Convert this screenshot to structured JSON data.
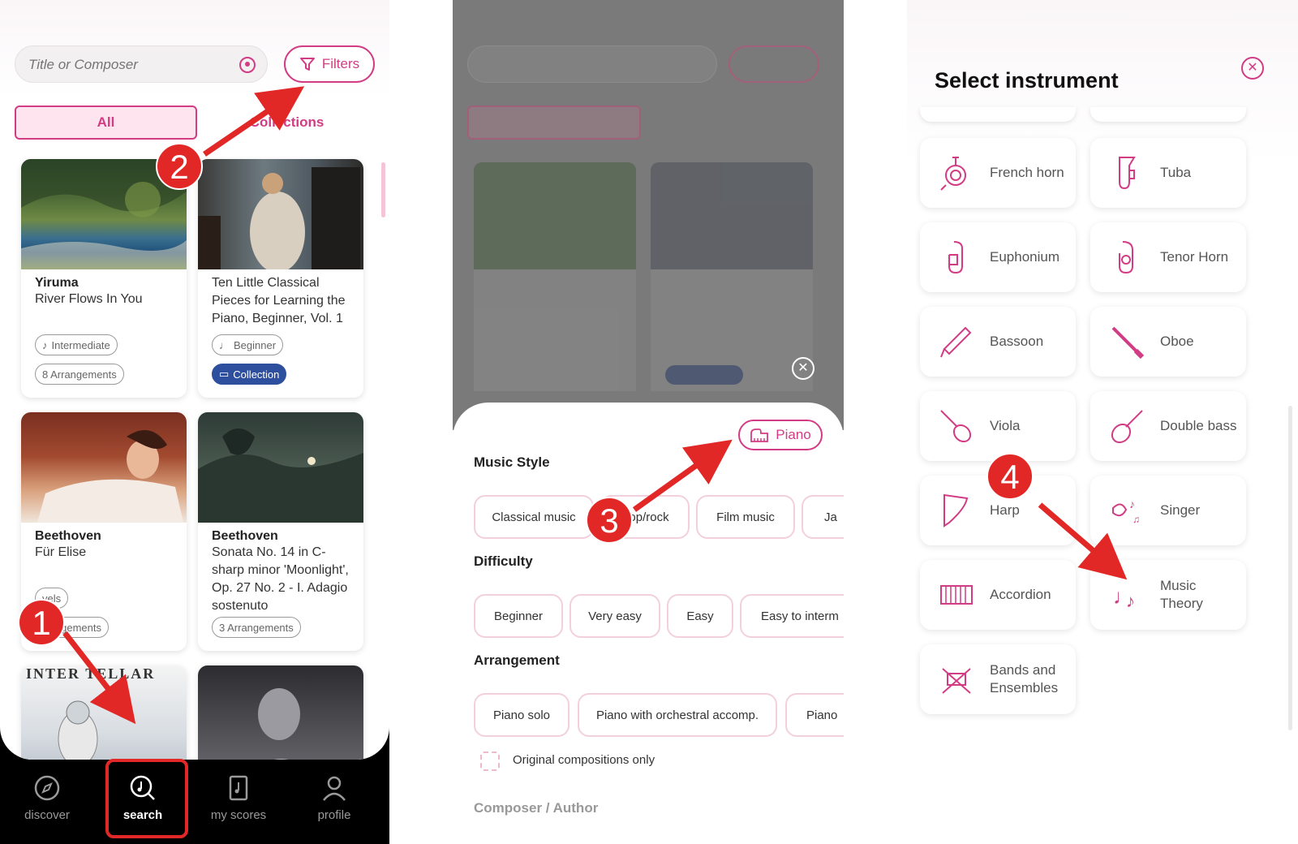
{
  "panel1": {
    "search_placeholder": "Title or Composer",
    "filters_label": "Filters",
    "tabs": [
      "All",
      "Collections"
    ],
    "cards": [
      {
        "composer": "Yiruma",
        "title": "River Flows In You",
        "level": "Intermediate",
        "arrangements": "8 Arrangements"
      },
      {
        "composer": "",
        "title": "Ten Little Classical Pieces for Learning the Piano, Beginner, Vol. 1",
        "level": "Beginner",
        "collection": "Collection"
      },
      {
        "composer": "Beethoven",
        "title": "Für Elise",
        "level": "vels",
        "arrangements": "rrangements"
      },
      {
        "composer": "Beethoven",
        "title": "Sonata No. 14 in C-sharp minor 'Moonlight', Op. 27 No. 2 - I. Adagio sostenuto",
        "arrangements": "3 Arrangements"
      }
    ],
    "thumb5_text": "INTER  TELLAR",
    "nav": [
      "discover",
      "search",
      "my scores",
      "profile"
    ]
  },
  "panel2": {
    "instrument_button": "Piano",
    "music_style_title": "Music Style",
    "music_styles": [
      "Classical music",
      "Pop/rock",
      "Film music",
      "Ja"
    ],
    "difficulty_title": "Difficulty",
    "difficulties": [
      "Beginner",
      "Very easy",
      "Easy",
      "Easy to interm"
    ],
    "arrangement_title": "Arrangement",
    "arrangements": [
      "Piano solo",
      "Piano with orchestral accomp.",
      "Piano"
    ],
    "original_only": "Original compositions only",
    "composer_title": "Composer / Author"
  },
  "panel3": {
    "title": "Select instrument",
    "instruments": [
      {
        "label": "French horn",
        "icon": "french-horn-icon"
      },
      {
        "label": "Tuba",
        "icon": "tuba-icon"
      },
      {
        "label": "Euphonium",
        "icon": "euphonium-icon"
      },
      {
        "label": "Tenor Horn",
        "icon": "tenor-horn-icon"
      },
      {
        "label": "Bassoon",
        "icon": "bassoon-icon"
      },
      {
        "label": "Oboe",
        "icon": "oboe-icon"
      },
      {
        "label": "Viola",
        "icon": "viola-icon"
      },
      {
        "label": "Double bass",
        "icon": "double-bass-icon"
      },
      {
        "label": "Harp",
        "icon": "harp-icon"
      },
      {
        "label": "Singer",
        "icon": "singer-icon"
      },
      {
        "label": "Accordion",
        "icon": "accordion-icon"
      },
      {
        "label": "Music Theory",
        "icon": "music-notes-icon"
      },
      {
        "label": "Bands and Ensembles",
        "icon": "ensemble-icon"
      }
    ]
  },
  "steps": [
    "1",
    "2",
    "3",
    "4"
  ],
  "colors": {
    "accent": "#d23c84",
    "annotation": "#e22826",
    "collection": "#2d4f9e"
  }
}
